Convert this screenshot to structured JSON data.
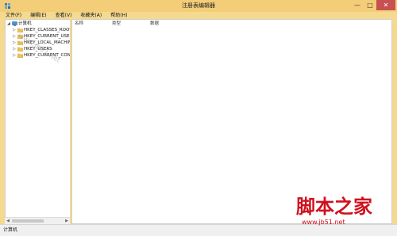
{
  "window": {
    "title": "注册表编辑器",
    "min_glyph": "—",
    "max_glyph": "□",
    "close_glyph": "✕"
  },
  "menu": [
    "文件(F)",
    "编辑(E)",
    "查看(V)",
    "收藏夹(A)",
    "帮助(H)"
  ],
  "tree": {
    "root": {
      "label": "计算机",
      "expander": "◢"
    },
    "children": [
      {
        "label": "HKEY_CLASSES_ROOT",
        "expander": "▷"
      },
      {
        "label": "HKEY_CURRENT_USER",
        "expander": "▷"
      },
      {
        "label": "HKEY_LOCAL_MACHINE",
        "expander": "▷"
      },
      {
        "label": "HKEY_USERS",
        "expander": "▷"
      },
      {
        "label": "HKEY_CURRENT_CONFIG",
        "expander": "▷"
      }
    ]
  },
  "list": {
    "columns": [
      "名称",
      "类型",
      "数据"
    ]
  },
  "status": "计算机",
  "watermark": {
    "diagonal": "www.jb51.net",
    "logo": "脚本之家",
    "url": "www.jb51.net"
  },
  "colors": {
    "frame": "#f5d98f",
    "titlebar": "#f3cd77",
    "close": "#c75050",
    "folder": "#e8c15a",
    "watermark": "#d0101e"
  }
}
